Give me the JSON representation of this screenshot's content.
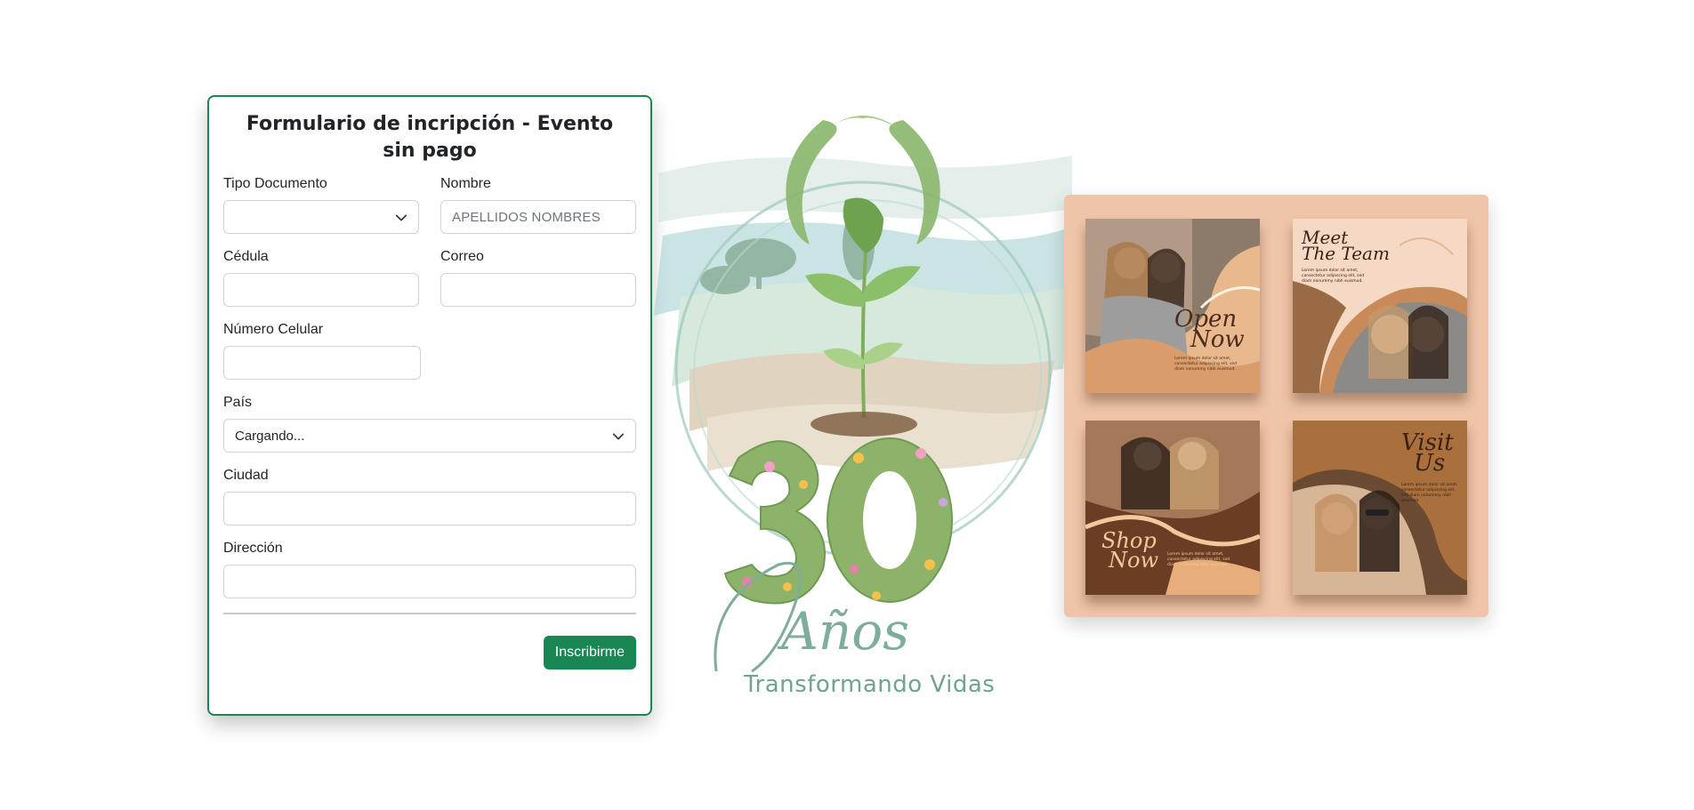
{
  "form": {
    "title": "Formulario de incripción - Evento sin pago",
    "fields": {
      "tipo_documento": {
        "label": "Tipo Documento",
        "value": ""
      },
      "nombre": {
        "label": "Nombre",
        "placeholder": "APELLIDOS NOMBRES"
      },
      "cedula": {
        "label": "Cédula",
        "value": ""
      },
      "correo": {
        "label": "Correo",
        "value": ""
      },
      "celular": {
        "label": "Número Celular",
        "value": ""
      },
      "pais": {
        "label": "País",
        "value": "Cargando..."
      },
      "ciudad": {
        "label": "Ciudad",
        "value": ""
      },
      "direccion": {
        "label": "Dirección",
        "value": ""
      }
    },
    "submit_label": "Inscribirme"
  },
  "logo": {
    "number": "30",
    "word": "Años",
    "tagline": "Transformando Vidas"
  },
  "promo": {
    "tiles": [
      {
        "title_line1": "Open",
        "title_line2": "Now",
        "small_text": "Lorem ipsum dolor sit amet, consectetur adipiscing elit, sed diam nonummy nibh euismod."
      },
      {
        "title_line1": "Meet",
        "title_line2": "The Team",
        "small_text": "Lorem ipsum dolor sit amet, consectetur adipiscing elit, sed diam nonummy nibh euismod."
      },
      {
        "title_line1": "Shop",
        "title_line2": "Now",
        "small_text": "Lorem ipsum dolor sit amet, consectetur adipiscing elit, sed diam nonummy nibh euismod."
      },
      {
        "title_line1": "Visit",
        "title_line2": "Us",
        "small_text": "Lorem ipsum dolor sit amet, consectetur adipiscing elit, sed diam nonummy nibh euismod."
      }
    ]
  },
  "colors": {
    "accent": "#198754",
    "promo_bg": "#f0c4a8",
    "logo_green": "#6fa48f"
  },
  "icons": {
    "select_caret": "chevron-down-icon"
  }
}
